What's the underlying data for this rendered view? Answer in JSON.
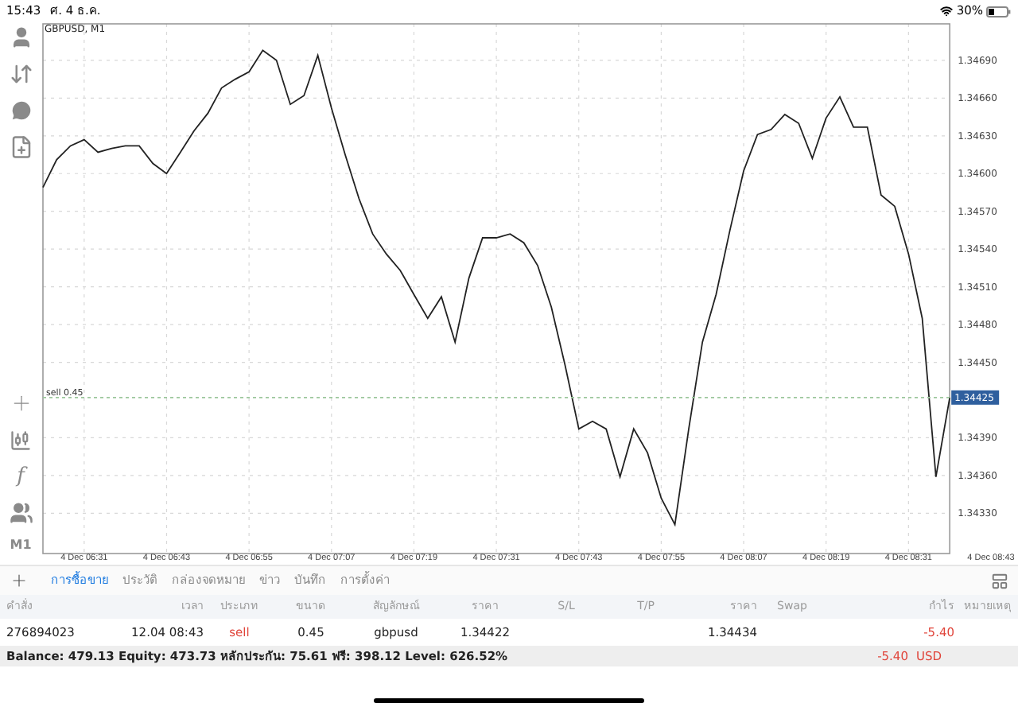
{
  "status_bar": {
    "time": "15:43",
    "date": "ศ. 4 ธ.ค.",
    "battery": "30%"
  },
  "toolbar": {
    "indicator_label": "f",
    "timeframe": "M1"
  },
  "chart": {
    "title": "GBPUSD, M1",
    "price_tag": "1.34425",
    "chart_data": {
      "type": "line",
      "grid": true,
      "ref_lines": [
        {
          "axis": "y",
          "value": 1.34422,
          "label": "sell 0.45",
          "color": "#9cc79c"
        }
      ],
      "categories": [
        null,
        null,
        null,
        "4 Dec 06:31",
        null,
        null,
        null,
        null,
        null,
        "4 Dec 06:43",
        null,
        null,
        null,
        null,
        null,
        "4 Dec 06:55",
        null,
        null,
        null,
        null,
        null,
        "4 Dec 07:07",
        null,
        null,
        null,
        null,
        null,
        "4 Dec 07:19",
        null,
        null,
        null,
        null,
        null,
        "4 Dec 07:31",
        null,
        null,
        null,
        null,
        null,
        "4 Dec 07:43",
        null,
        null,
        null,
        null,
        null,
        "4 Dec 07:55",
        null,
        null,
        null,
        null,
        null,
        "4 Dec 08:07",
        null,
        null,
        null,
        null,
        null,
        "4 Dec 08:19",
        null,
        null,
        null,
        null,
        null,
        "4 Dec 08:31",
        null,
        null,
        null,
        null,
        null,
        "4 Dec 08:43"
      ],
      "series": [
        {
          "color": "#222222",
          "values": [
            1.34589,
            1.34611,
            1.34622,
            1.34627,
            1.34617,
            1.3462,
            1.34622,
            1.34622,
            1.34608,
            1.346,
            1.34617,
            1.34634,
            1.34648,
            1.34668,
            1.34675,
            1.34681,
            1.34698,
            1.3469,
            1.34655,
            1.34662,
            1.34694,
            1.34652,
            1.34615,
            1.3458,
            1.34552,
            1.34536,
            1.34523,
            1.34504,
            1.34485,
            1.34502,
            1.34466,
            1.34517,
            1.34549,
            1.34549,
            1.34552,
            1.34545,
            1.34527,
            1.34494,
            1.34448,
            1.34397,
            1.34403,
            1.34397,
            1.34359,
            1.34397,
            1.34378,
            1.34342,
            1.34321,
            1.34397,
            1.34466,
            1.34504,
            1.34555,
            1.34602,
            1.34631,
            1.34635,
            1.34647,
            1.3464,
            1.34612,
            1.34644,
            1.34661,
            1.34637,
            1.34637,
            1.34583,
            1.34574,
            1.34536,
            1.34485,
            1.34359,
            1.34422,
            null,
            null,
            null
          ]
        }
      ],
      "ylim": [
        1.34298,
        1.34719
      ],
      "yticks": [
        {
          "value": 1.3433,
          "label": "1.34330"
        },
        {
          "value": 1.3436,
          "label": "1.34360"
        },
        {
          "value": 1.3439,
          "label": "1.34390"
        },
        {
          "value": 1.3445,
          "label": "1.34450"
        },
        {
          "value": 1.3448,
          "label": "1.34480"
        },
        {
          "value": 1.3451,
          "label": "1.34510"
        },
        {
          "value": 1.3454,
          "label": "1.34540"
        },
        {
          "value": 1.3457,
          "label": "1.34570"
        },
        {
          "value": 1.346,
          "label": "1.34600"
        },
        {
          "value": 1.3463,
          "label": "1.34630"
        },
        {
          "value": 1.3466,
          "label": "1.34660"
        },
        {
          "value": 1.3469,
          "label": "1.34690"
        }
      ]
    }
  },
  "tabs": [
    {
      "label": "การซื้อขาย",
      "selected": true
    },
    {
      "label": "ประวัติ",
      "selected": false
    },
    {
      "label": "กล่องจดหมาย",
      "selected": false
    },
    {
      "label": "ข่าว",
      "selected": false
    },
    {
      "label": "บันทึก",
      "selected": false
    },
    {
      "label": "การตั้งค่า",
      "selected": false
    }
  ],
  "table": {
    "columns": [
      "คำสั่ง",
      "เวลา",
      "ประเภท",
      "ขนาด",
      "สัญลักษณ์",
      "ราคา",
      "S/L",
      "T/P",
      "ราคา",
      "Swap",
      "กำไร",
      "หมายเหตุ"
    ],
    "rows": [
      {
        "cells": [
          {
            "kind": "plain",
            "text": "276894023"
          },
          {
            "kind": "plain",
            "text": "12.04 08:43"
          },
          {
            "kind": "loss",
            "text": "sell"
          },
          {
            "kind": "plain",
            "text": "0.45"
          },
          {
            "kind": "plain",
            "text": "gbpusd"
          },
          {
            "kind": "plain",
            "text": "1.34422"
          },
          {
            "kind": "empty"
          },
          {
            "kind": "empty"
          },
          {
            "kind": "plain",
            "text": "1.34434"
          },
          {
            "kind": "empty"
          },
          {
            "kind": "loss",
            "text": "-5.40"
          },
          {
            "kind": "empty"
          }
        ]
      }
    ]
  },
  "summary": {
    "text": "Balance: 479.13 Equity: 473.73 หลักประกัน: 75.61 ฟรี: 398.12 Level: 626.52%",
    "profit": "-5.40",
    "currency": "USD"
  }
}
